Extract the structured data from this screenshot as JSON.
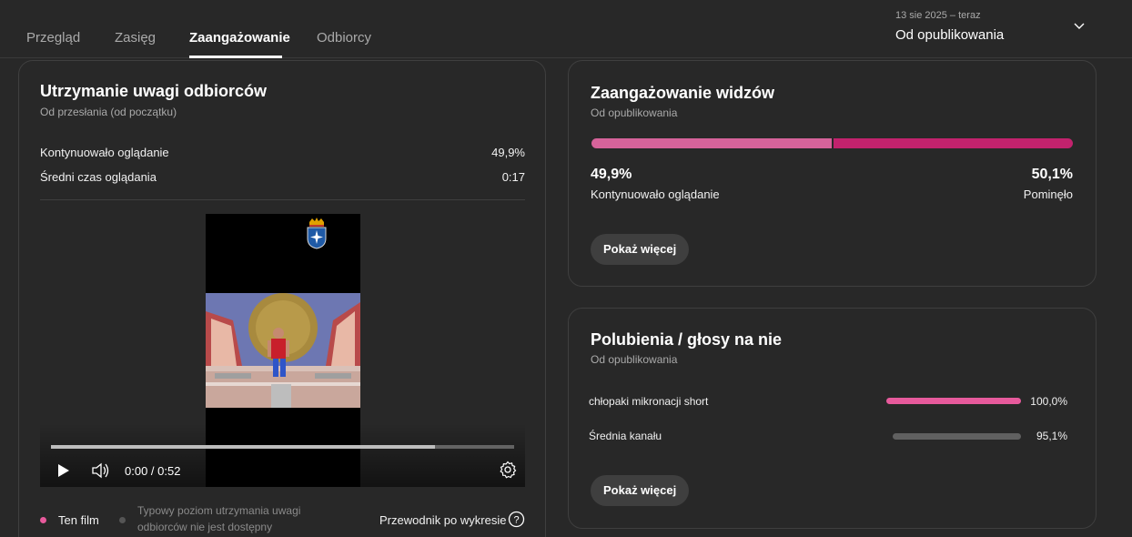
{
  "tabs": [
    {
      "label": "Przegląd",
      "active": false
    },
    {
      "label": "Zasięg",
      "active": false
    },
    {
      "label": "Zaangażowanie",
      "active": true
    },
    {
      "label": "Odbiorcy",
      "active": false
    }
  ],
  "date_range": {
    "range_label": "13 sie 2025 – teraz",
    "selected": "Od opublikowania",
    "icon": "chevron-down-icon"
  },
  "retention_card": {
    "title": "Utrzymanie uwagi odbiorców",
    "subtitle": "Od przesłania (od początku)",
    "stats": [
      {
        "label": "Kontynuowało oglądanie",
        "value": "49,9%"
      },
      {
        "label": "Średni czas oglądania",
        "value": "0:17"
      }
    ],
    "player": {
      "time": "0:00 / 0:52",
      "progress": 0.83,
      "icons": [
        "play-icon",
        "volume-icon",
        "settings-gear-icon"
      ]
    },
    "legend": {
      "this_film": "Ten film",
      "typical_line1": "Typowy poziom utrzymania uwagi",
      "typical_line2": "odbiorców nie jest dostępny",
      "guide": "Przewodnik po wykresie",
      "guide_icon": "help-circle-icon"
    }
  },
  "engagement_card": {
    "title": "Zaangażowanie widzów",
    "subtitle": "Od opublikowania",
    "continued_pct": "49,9%",
    "continued_label": "Kontynuowało oglądanie",
    "continued_fraction": 0.499,
    "skipped_pct": "50,1%",
    "skipped_label": "Pominęło",
    "button": "Pokaż więcej"
  },
  "likes_card": {
    "title": "Polubienia / głosy na nie",
    "subtitle": "Od opublikowania",
    "rows": [
      {
        "label": "chłopaki mikronacji short",
        "value": "100,0%",
        "fraction": 1.0
      },
      {
        "label": "Średnia kanału",
        "value": "95,1%",
        "fraction": 0.951
      }
    ],
    "button": "Pokaż więcej"
  },
  "colors": {
    "background": "#282828",
    "accent_pink": "#d6639a",
    "accent_magenta": "#c2226d",
    "like_bar": "#e75a9c",
    "neutral_bar": "#606060"
  }
}
